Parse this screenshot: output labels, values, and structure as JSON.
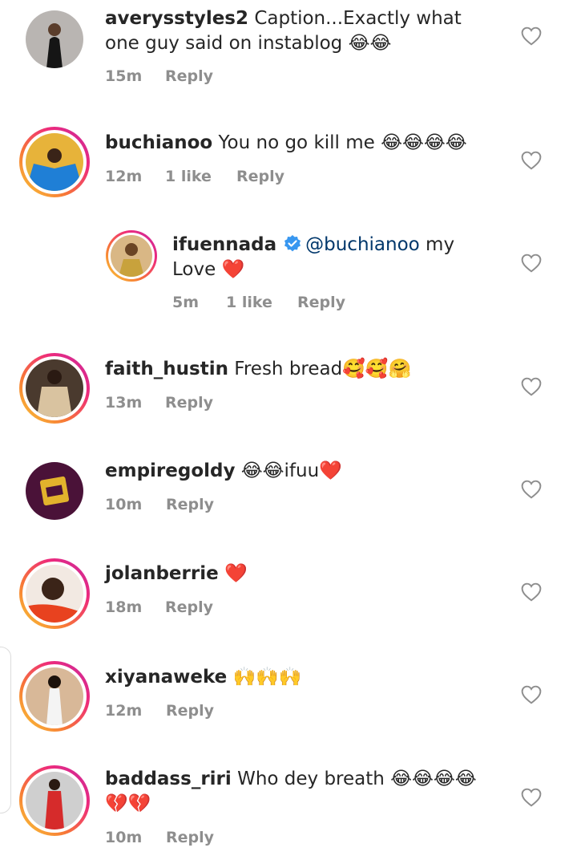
{
  "comments": [
    {
      "username": "averysstyles2",
      "text": "Caption...Exactly what one guy said on instablog 😂😂",
      "time": "15m",
      "likes": "",
      "reply": "Reply",
      "avatar_icon": "profile-photo",
      "ring": false
    },
    {
      "username": "buchianoo",
      "text": "You no go kill me 😂😂😂😂",
      "time": "12m",
      "likes": "1 like",
      "reply": "Reply",
      "avatar_icon": "profile-photo",
      "ring": true
    },
    {
      "username": "ifuennada",
      "verified": true,
      "mention": "@buchianoo",
      "text": " my Love ❤️",
      "time": "5m",
      "likes": "1 like",
      "reply": "Reply",
      "avatar_icon": "profile-photo",
      "ring": true,
      "is_reply": true
    },
    {
      "username": "faith_hustin",
      "text": "Fresh bread🥰🥰🤗",
      "time": "13m",
      "likes": "",
      "reply": "Reply",
      "avatar_icon": "profile-photo",
      "ring": true
    },
    {
      "username": "empiregoldy",
      "text": "😂😂ifuu❤️",
      "time": "10m",
      "likes": "",
      "reply": "Reply",
      "avatar_icon": "brand-logo",
      "ring": false
    },
    {
      "username": "jolanberrie",
      "text": "❤️",
      "time": "18m",
      "likes": "",
      "reply": "Reply",
      "avatar_icon": "profile-photo",
      "ring": true
    },
    {
      "username": "xiyanaweke",
      "text": "🙌🙌🙌",
      "time": "12m",
      "likes": "",
      "reply": "Reply",
      "avatar_icon": "profile-photo",
      "ring": true
    },
    {
      "username": "baddass_riri",
      "text": "Who dey breath 😂😂😂😂💔💔",
      "time": "10m",
      "likes": "",
      "reply": "Reply",
      "avatar_icon": "profile-photo",
      "ring": true
    }
  ],
  "colors": {
    "text": "#262626",
    "meta": "#8e8e8e",
    "mention": "#00376b",
    "verified": "#3897f0",
    "heart_outline": "#8e8e8e"
  }
}
